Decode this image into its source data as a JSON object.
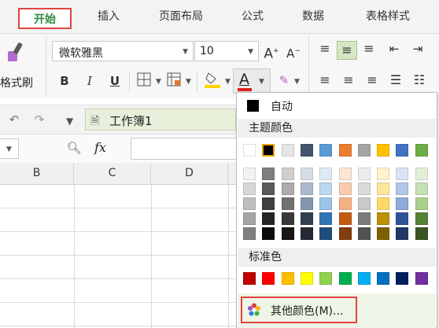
{
  "tabs": [
    "开始",
    "插入",
    "页面布局",
    "公式",
    "数据",
    "表格样式"
  ],
  "font": {
    "name": "微软雅黑",
    "size": "10"
  },
  "ribbon": {
    "format_painter": "格式刷",
    "bold": "B",
    "italic": "I",
    "underline": "U",
    "font_color_letter": "A"
  },
  "toolbar": {
    "doc_name": "工作簿1"
  },
  "formula_bar": {
    "fx": "fx"
  },
  "sheet": {
    "columns": [
      "B",
      "C",
      "D"
    ]
  },
  "color_menu": {
    "auto_label": "自动",
    "theme_header": "主题颜色",
    "standard_header": "标准色",
    "more_colors_label": "其他颜色(M)...",
    "theme_top": [
      "#ffffff",
      "#000000",
      "#e7e6e6",
      "#44546a",
      "#5b9bd5",
      "#ed7d31",
      "#a5a5a5",
      "#ffc000",
      "#4472c4",
      "#70ad47"
    ],
    "theme_shades": [
      [
        "#f2f2f2",
        "#7f7f7f",
        "#d0cece",
        "#d6dce4",
        "#deebf6",
        "#fbe5d5",
        "#ededed",
        "#fff2cc",
        "#dae3f3",
        "#e2efd9"
      ],
      [
        "#d8d8d8",
        "#595959",
        "#aeabab",
        "#adb9ca",
        "#bdd7ee",
        "#f7cbac",
        "#dbdbdb",
        "#fee599",
        "#b4c6e7",
        "#c5e0b3"
      ],
      [
        "#bfbfbf",
        "#3f3f3f",
        "#757070",
        "#8496b0",
        "#9dc3e6",
        "#f4b183",
        "#c9c9c9",
        "#ffd965",
        "#8eaadb",
        "#a8d08d"
      ],
      [
        "#a5a5a5",
        "#262626",
        "#3a3838",
        "#323f4f",
        "#2e75b5",
        "#c55a11",
        "#7b7b7b",
        "#bf9000",
        "#2f5496",
        "#538135"
      ],
      [
        "#7f7f7f",
        "#0c0c0c",
        "#171616",
        "#222a35",
        "#1e4e79",
        "#833c0b",
        "#525252",
        "#7f6000",
        "#1f3864",
        "#375623"
      ]
    ],
    "standard": [
      "#c00000",
      "#ff0000",
      "#ffc000",
      "#ffff00",
      "#92d050",
      "#00b050",
      "#00b0f0",
      "#0070c0",
      "#002060",
      "#7030a0"
    ]
  }
}
